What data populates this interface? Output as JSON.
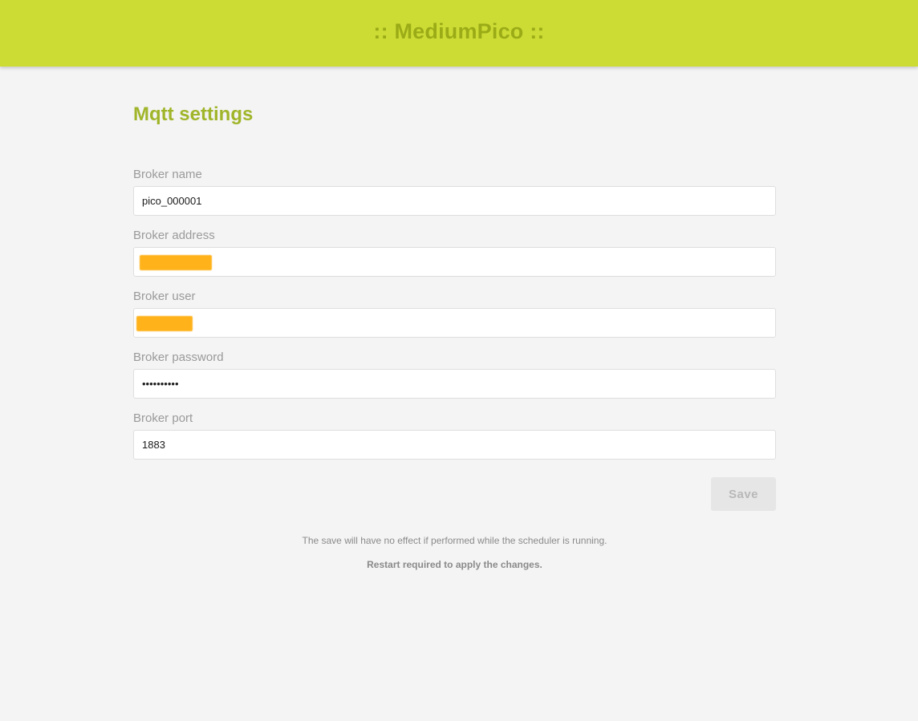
{
  "header": {
    "app_title": ":: MediumPico ::"
  },
  "page": {
    "title": "Mqtt settings"
  },
  "form": {
    "broker_name": {
      "label": "Broker name",
      "value": "pico_000001"
    },
    "broker_address": {
      "label": "Broker address",
      "value": ""
    },
    "broker_user": {
      "label": "Broker user",
      "value": ""
    },
    "broker_password": {
      "label": "Broker password",
      "value": "••••••••••"
    },
    "broker_port": {
      "label": "Broker port",
      "value": "1883"
    },
    "save_label": "Save"
  },
  "notes": {
    "scheduler_warning": "The save will have no effect if performed while the scheduler is running.",
    "restart_notice": "Restart required to apply the changes."
  },
  "colors": {
    "header_bg": "#cddc35",
    "title_accent": "#a1b52a",
    "redaction": "#ffb21a",
    "page_bg": "#f4f4f4"
  }
}
